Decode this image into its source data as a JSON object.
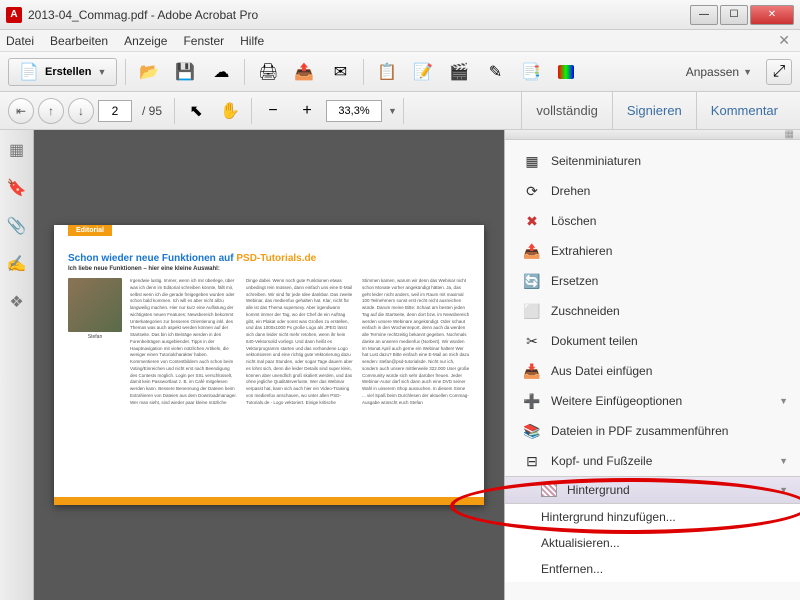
{
  "window": {
    "title": "2013-04_Commag.pdf - Adobe Acrobat Pro"
  },
  "menu": {
    "datei": "Datei",
    "bearbeiten": "Bearbeiten",
    "anzeige": "Anzeige",
    "fenster": "Fenster",
    "hilfe": "Hilfe"
  },
  "toolbar": {
    "create_label": "Erstellen",
    "anpassen_label": "Anpassen"
  },
  "nav": {
    "current_page": "2",
    "total_pages": "/ 95",
    "zoom": "33,3%"
  },
  "right_tabs": {
    "vollstaendig": "vollständig",
    "signieren": "Signieren",
    "kommentar": "Kommentar"
  },
  "document": {
    "editorial_tab": "Editorial",
    "headline_pre": "Schon wieder neue Funktionen auf ",
    "headline_link": "PSD-Tutorials.de",
    "subhead": "Ich liebe neue Funktionen – hier eine kleine Auswahl:",
    "author": "Stefan",
    "body_text": "Irgendwie lustig. Immer, wenn ich mir überlege, über was ich denn im Editorial schreiben könnte, fällt mir, selbst wenn ich die gerade freigegeben wurden oder schon bald kommen. Ich will es aber nicht allzu langweilig machen. Hier nur kurz eine Auflistung der wichtigsten neuen Features: Newsbereich bekommt Unterkategorien zur besseren Orientierung inkl. des Themas was auch aspekt werden können auf der Startseite. Das bin ich Beiträge werden in den Forenbeiträgen ausgeblendet. Tipps in der Hauptnavigation mit vielen nützlichen Artikeln, die weniger einen Tutorialcharakter haben. Kommentieren von Contestbildern auch schon beim Voting/Einreichen und nicht erst nach Beendigung des Contests möglich. Login per SSL verschlüsselt, damit kein Passwortlaut z. B. im Café mitgelesen werden kann. Bessere Benennung der Dateien beim Extrahieren von Dateien aus dem Downloadmanager. Wer man sieht, sind wieder paar kleine nützliche Dinge dabei. Wenn noch gute Funktionen etwas unbedingt rein müssen, dann einfach uns eine E-Mail schreiben. Wir sind für jede Idee dankbar. Das zweite Webinar, das medienfux gehalten hat. Klar, nicht für alle ist das Thema supersexy. Aber irgendwann kommt immer der Tag, wo der Chef de ein Auftrag gibt, ein Plakat oder sonst was Großes zu erstellen, und das 1000x1000 Px große Logo als JPEG lässt sich dann leider nicht mehr retohen, wenn ihr kein 640-Vektorsolid vorliegt. Und dann heißt es Vektorprogramm starten und das vorhandene Logo vektorisieren und eine richtig gute Vektorierung dazu nicht mal paar Stunden, oder sogar Tage dauern aber es lohnt sich, denn die leider Details sind super klein, können aber unendlich groß skaliert werden, und das ohne jegliche Qualitätsverluste. Wer das Webinar verpasst hat, kann sich auch hier ein Video-Training von medienfux anschauen, wo unter allen PSD-Tutorials.de - Logo vektoriert. Einige kritische Stimmen kamen, warum wir denn das Webinar nicht schon Monate vorher angekündigt hätten. Ja, das geht leider nicht anders, weil im Raum mit maximal 100 Teilnehmern sonst erst recht nicht ausreichen würde. Darum meine Bitte: Schaut am besten jeden Tag auf die Startseite, denn dort bzw. im Newsbereich werden unsere Webinare angekündigt. Oder schaut einfach in den Wochenreport, denn auch da werden alle Termine rechtzeitig bekannt gegeben. Nochmals danke an unseren medienfux (Norbert). Wir würden im Monat April auch gerne ein Webinar halten! Wer hat Lust dazu? Bitte einfach eine E-Mail an mich dazu senden: stefan@psd-tutorialsde. Nicht nur ich, sondern auch unsere mittlerweile 322.000 User große Community würde sich sehr darüber freuen. Jeder Webinar-Autor darf sich dann auch eine DVD seiner Wahl in unserem Shop aussuchen. In diesem Sinne ... viel Spaß beim Durchlesen der aktuellen Commag-Ausgabe wünscht euch Stefan"
  },
  "panel": {
    "items": [
      {
        "label": "Seitenminiaturen",
        "icon": "thumbnails"
      },
      {
        "label": "Drehen",
        "icon": "rotate"
      },
      {
        "label": "Löschen",
        "icon": "delete"
      },
      {
        "label": "Extrahieren",
        "icon": "extract"
      },
      {
        "label": "Ersetzen",
        "icon": "replace"
      },
      {
        "label": "Zuschneiden",
        "icon": "crop"
      },
      {
        "label": "Dokument teilen",
        "icon": "split"
      },
      {
        "label": "Aus Datei einfügen",
        "icon": "insert"
      },
      {
        "label": "Weitere Einfügeoptionen",
        "icon": "more-insert",
        "chevron": true
      },
      {
        "label": "Dateien in PDF zusammenführen",
        "icon": "combine"
      },
      {
        "label": "Kopf- und Fußzeile",
        "icon": "header-footer",
        "chevron": true
      },
      {
        "label": "Hintergrund",
        "icon": "background",
        "chevron": true,
        "highlighted": true
      }
    ],
    "submenu": [
      {
        "label": "Hintergrund hinzufügen..."
      },
      {
        "label": "Aktualisieren..."
      },
      {
        "label": "Entfernen..."
      }
    ]
  }
}
